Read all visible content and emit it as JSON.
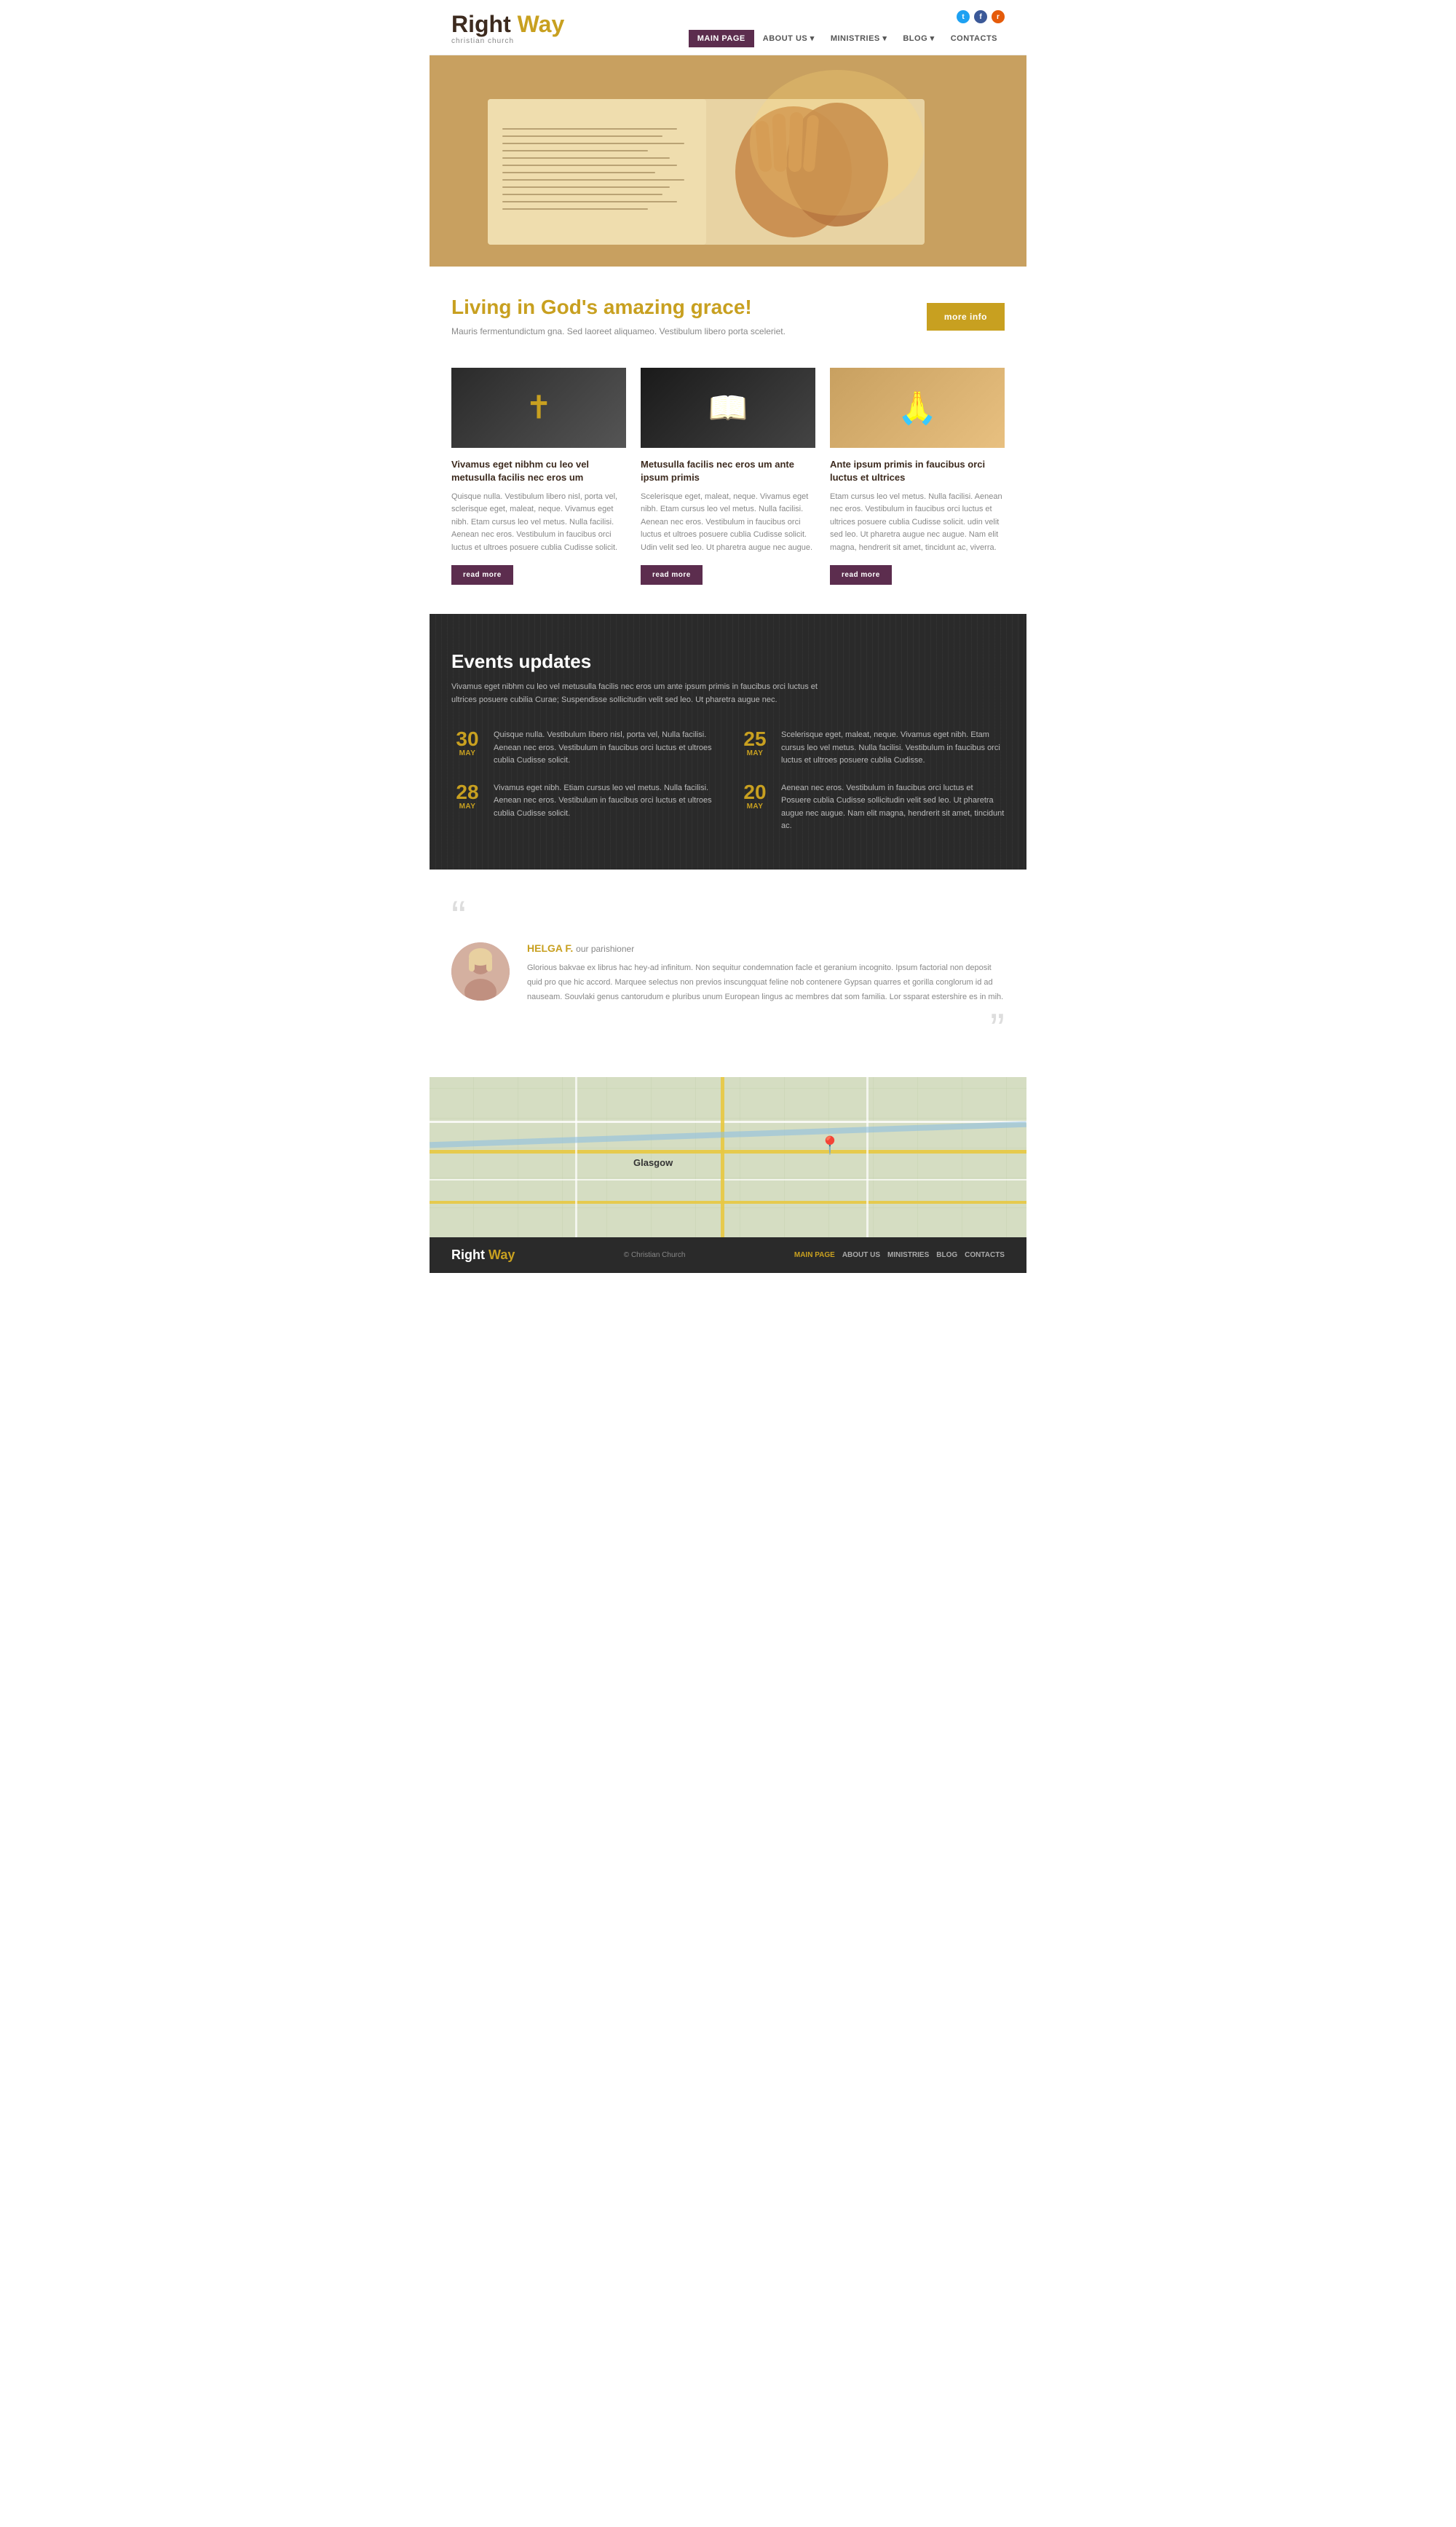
{
  "header": {
    "logo_right": "Right",
    "logo_way": "Way",
    "logo_sub": "christian church",
    "nav": [
      {
        "label": "MAIN PAGE",
        "active": true
      },
      {
        "label": "ABOUT US",
        "active": false,
        "dropdown": true
      },
      {
        "label": "MINISTRIES",
        "active": false,
        "dropdown": true
      },
      {
        "label": "BLOG",
        "active": false,
        "dropdown": true
      },
      {
        "label": "CONTACTS",
        "active": false
      }
    ],
    "social": [
      {
        "name": "twitter",
        "symbol": "t"
      },
      {
        "name": "facebook",
        "symbol": "f"
      },
      {
        "name": "rss",
        "symbol": "r"
      }
    ]
  },
  "hero": {
    "alt": "Praying hands over Bible"
  },
  "grace": {
    "title": "Living in God's amazing grace!",
    "subtitle": "Mauris fermentundictum gna.  Sed laoreet aliquameo. Vestibulum libero porta sceleriet.",
    "btn_label": "more info"
  },
  "cards": [
    {
      "type": "cross",
      "title": "Vivamus eget nibhm cu leo vel metusulla facilis nec eros um",
      "text": "Quisque nulla. Vestibulum libero nisl, porta vel, sclerisque eget, maleat, neque. Vivamus eget nibh. Etam cursus leo vel metus. Nulla facilisi. Aenean nec eros. Vestibulum  in faucibus orci luctus et ultroes posuere cublia Cudisse solicit.",
      "btn": "read more"
    },
    {
      "type": "book",
      "title": "Metusulla facilis nec eros um ante ipsum primis",
      "text": "Scelerisque eget, maleat, neque. Vivamus eget nibh. Etam cursus leo vel metus. Nulla facilisi. Aenean nec eros. Vestibulum  in faucibus orci luctus et ultroes posuere cublia Cudisse solicit. Udin velit sed leo. Ut pharetra augue nec augue.",
      "btn": "read more"
    },
    {
      "type": "pray",
      "title": "Ante ipsum primis  in faucibus orci luctus et ultrices",
      "text": "Etam cursus leo vel metus. Nulla facilisi. Aenean nec eros. Vestibulum  in faucibus orci luctus et ultrices posuere cublia Cudisse solicit. udin velit sed leo. Ut pharetra augue nec augue. Nam elit magna, hendrerit sit amet, tincidunt ac, viverra.",
      "btn": "read more"
    }
  ],
  "events": {
    "title": "Events updates",
    "subtitle": "Vivamus eget nibhm cu leo vel metusulla facilis nec eros um ante ipsum primis  in faucibus orci luctus et ultrices posuere cubilia Curae; Suspendisse sollicitudin velit sed leo. Ut pharetra augue nec.",
    "items": [
      {
        "day": "30",
        "month": "MAY",
        "text": "Quisque nulla. Vestibulum libero nisl, porta vel, Nulla facilisi. Aenean nec eros. Vestibulum  in faucibus orci luctus et ultroes cublia Cudisse solicit."
      },
      {
        "day": "25",
        "month": "MAY",
        "text": "Scelerisque eget, maleat, neque. Vivamus eget nibh. Etam cursus leo vel metus. Nulla facilisi. Vestibulum  in faucibus orci luctus et ultroes posuere cublia Cudisse."
      },
      {
        "day": "28",
        "month": "MAY",
        "text": "Vivamus eget nibh. Etiam cursus leo vel metus. Nulla facilisi. Aenean nec eros. Vestibulum  in faucibus orci luctus et ultroes cublia Cudisse solicit."
      },
      {
        "day": "20",
        "month": "MAY",
        "text": "Aenean nec eros. Vestibulum in faucibus orci luctus et Posuere cublia Cudisse sollicitudin velit sed leo. Ut pharetra augue nec augue. Nam elit magna, hendrerit sit amet, tincidunt ac."
      }
    ]
  },
  "testimonial": {
    "quote_open": "“",
    "quote_close": "”",
    "name_gold": "HELGA F.",
    "role": "our parishioner",
    "text": "Glorious bakvae ex librus hac hey-ad infinitum. Non sequitur condemnation facle et geranium incognito. Ipsum factorial non deposit quid pro que hic accord. Marquee selectus non previos inscungquat feline nob contenere Gypsan quarres et gorilla conglorum id ad nauseam. Souvlaki genus cantorudum e pluribus unum European lingus ac membres dat som familia. Lor ssparat estershire es in mih.",
    "avatar_emoji": "👩"
  },
  "map": {
    "alt": "Glasgow area map with location pin",
    "city_label": "Glasgow",
    "pin_label": "Location"
  },
  "footer": {
    "logo_right": "Right",
    "logo_way": "Way",
    "copyright": "© Christian Church",
    "nav": [
      {
        "label": "MAIN PAGE",
        "active": true
      },
      {
        "label": "ABOUT US",
        "active": false
      },
      {
        "label": "MINISTRIES",
        "active": false
      },
      {
        "label": "BLOG",
        "active": false
      },
      {
        "label": "CONTACTS",
        "active": false
      }
    ]
  }
}
